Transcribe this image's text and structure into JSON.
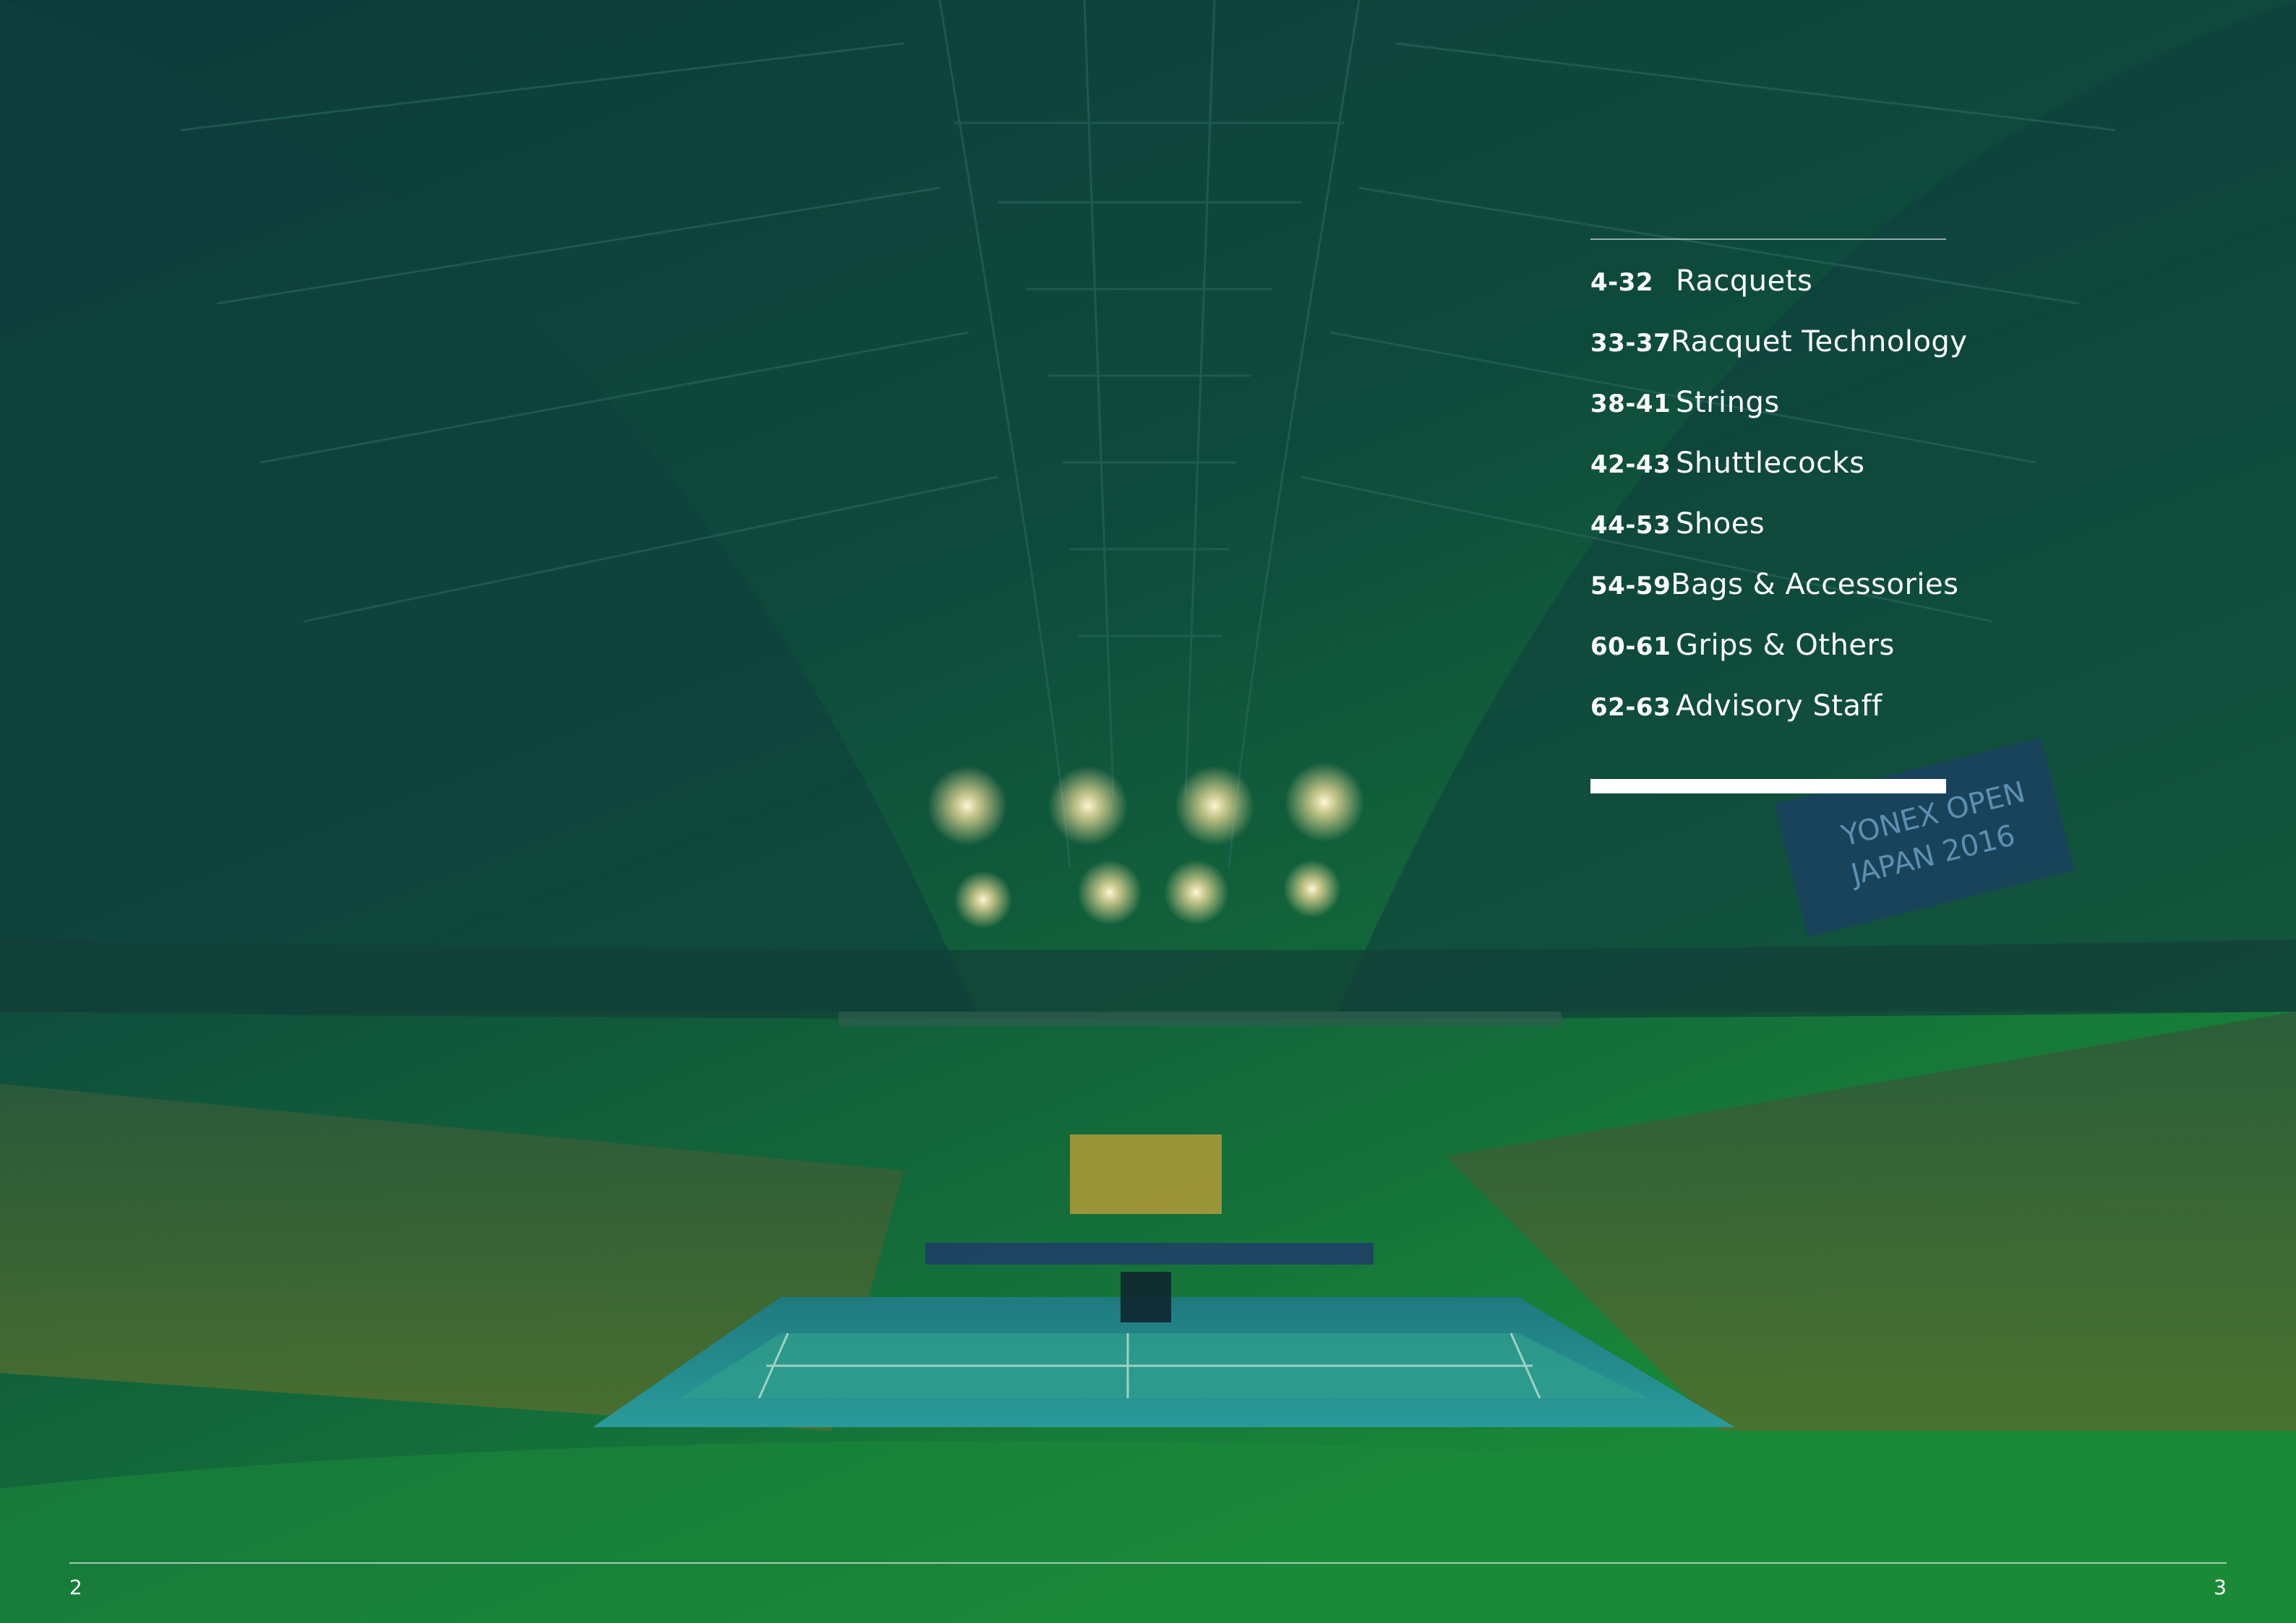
{
  "toc": {
    "items": [
      {
        "pages": "4-32",
        "title": "Racquets"
      },
      {
        "pages": "33-37",
        "title": "Racquet Technology"
      },
      {
        "pages": "38-41",
        "title": "Strings"
      },
      {
        "pages": "42-43",
        "title": "Shuttlecocks"
      },
      {
        "pages": "44-53",
        "title": "Shoes"
      },
      {
        "pages": "54-59",
        "title": "Bags & Accessories"
      },
      {
        "pages": "60-61",
        "title": "Grips & Others"
      },
      {
        "pages": "62-63",
        "title": "Advisory Staff"
      }
    ]
  },
  "banner": {
    "line1": "YONEX OPEN",
    "line2": "JAPAN 2016"
  },
  "footer": {
    "left_page": "2",
    "right_page": "3"
  },
  "colors": {
    "overlay_dark": "#0c3f36",
    "overlay_green": "#178a3a",
    "text": "#ffffff"
  }
}
